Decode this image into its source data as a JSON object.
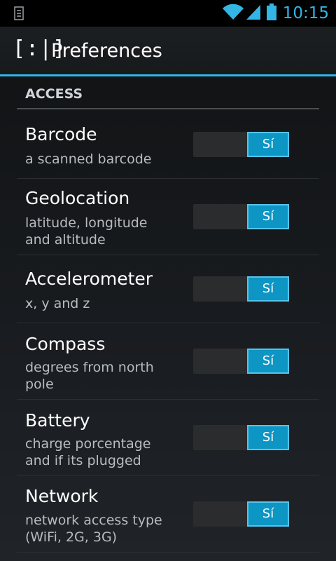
{
  "status_bar": {
    "time": "10:15",
    "left_icon": "usb-debug-icon",
    "wifi_icon": "wifi-icon",
    "signal_icon": "signal-icon",
    "battery_icon": "battery-icon"
  },
  "action_bar": {
    "logo": "[:|]",
    "title": "Preferences"
  },
  "section": {
    "header": "ACCESS"
  },
  "preferences": [
    {
      "title": "Barcode",
      "summary": "a scanned barcode",
      "toggle_label": "Sí",
      "enabled": true
    },
    {
      "title": "Geolocation",
      "summary": "latitude, longitude and altitude",
      "toggle_label": "Sí",
      "enabled": true
    },
    {
      "title": "Accelerometer",
      "summary": "x, y and z",
      "toggle_label": "Sí",
      "enabled": true
    },
    {
      "title": "Compass",
      "summary": "degrees from north pole",
      "toggle_label": "Sí",
      "enabled": true
    },
    {
      "title": "Battery",
      "summary": "charge porcentage and if its plugged",
      "toggle_label": "Sí",
      "enabled": true
    },
    {
      "title": "Network",
      "summary": "network access type (WiFi, 2G, 3G)",
      "toggle_label": "Sí",
      "enabled": true
    }
  ],
  "colors": {
    "accent": "#33b5e5",
    "toggle_on": "#0d95c4"
  }
}
